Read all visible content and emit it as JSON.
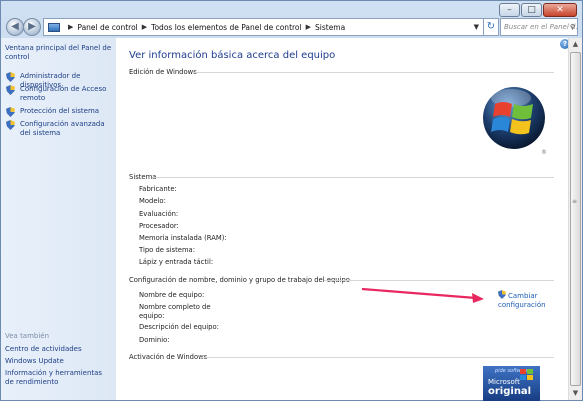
{
  "window": {
    "minimize": "–",
    "maximize": "□",
    "close": "✕"
  },
  "nav": {
    "back_icon": "arrow-left",
    "forward_icon": "arrow-right",
    "breadcrumb": [
      "Panel de control",
      "Todos los elementos de Panel de control",
      "Sistema"
    ],
    "search_placeholder": "Buscar en el Panel d...",
    "refresh_icon": "refresh",
    "search_icon": "magnifier"
  },
  "sidebar": {
    "home_link": "Ventana principal del Panel de control",
    "items": [
      {
        "label": "Administrador de dispositivos",
        "icon": "shield-icon"
      },
      {
        "label": "Configuración de Acceso remoto",
        "icon": "shield-icon"
      },
      {
        "label": "Protección del sistema",
        "icon": "shield-icon"
      },
      {
        "label": "Configuración avanzada del sistema",
        "icon": "shield-icon"
      }
    ],
    "see_also_title": "Vea también",
    "see_also": [
      "Centro de actividades",
      "Windows Update",
      "Información y herramientas de rendimiento"
    ]
  },
  "main": {
    "title": "Ver información básica acerca del equipo",
    "edition_section": "Edición de Windows",
    "system_section": "Sistema",
    "system_fields": [
      "Fabricante:",
      "Modelo:",
      "Evaluación:",
      "Procesador:",
      "Memoria instalada (RAM):",
      "Tipo de sistema:",
      "Lápiz y entrada táctil:"
    ],
    "name_section": "Configuración de nombre, dominio y grupo de trabajo del equipo",
    "name_fields": [
      "Nombre de equipo:",
      "Nombre completo de equipo:",
      "Descripción del equipo:",
      "Dominio:"
    ],
    "change_settings": "Cambiar configuración",
    "activation_section": "Activación de Windows",
    "genuine_badge": {
      "line1": "pide software",
      "line2": "Microsoft",
      "line3": "original"
    }
  },
  "colors": {
    "link": "#1e3f86",
    "title": "#1e3d8f",
    "annotation_arrow": "#e8285f"
  }
}
